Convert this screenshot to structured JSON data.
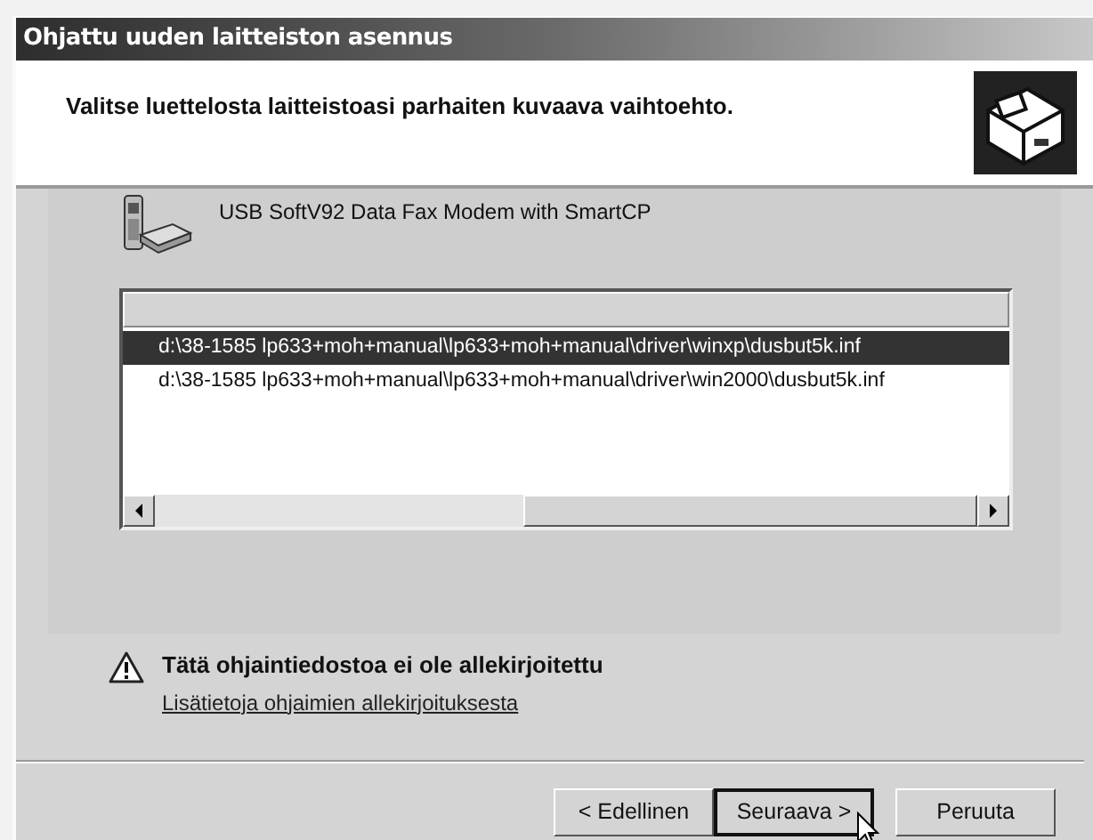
{
  "window": {
    "title": "Ohjattu uuden laitteiston asennus"
  },
  "header": {
    "instruction": "Valitse luettelosta laitteistoasi parhaiten kuvaava vaihtoehto."
  },
  "device": {
    "name": "USB SoftV92 Data Fax Modem with SmartCP"
  },
  "driver_list": {
    "rows": [
      {
        "path": "d:\\38-1585 lp633+moh+manual\\lp633+moh+manual\\driver\\winxp\\dusbut5k.inf",
        "selected": true
      },
      {
        "path": "d:\\38-1585 lp633+moh+manual\\lp633+moh+manual\\driver\\win2000\\dusbut5k.inf",
        "selected": false
      }
    ]
  },
  "warning": {
    "text": "Tätä ohjaintiedostoa ei ole allekirjoitettu",
    "link": "Lisätietoja ohjaimien allekirjoituksesta"
  },
  "buttons": [
    {
      "label": "< Edellinen",
      "default": false
    },
    {
      "label": "Seuraava >",
      "default": true
    },
    {
      "label": "Peruuta",
      "default": false
    }
  ]
}
